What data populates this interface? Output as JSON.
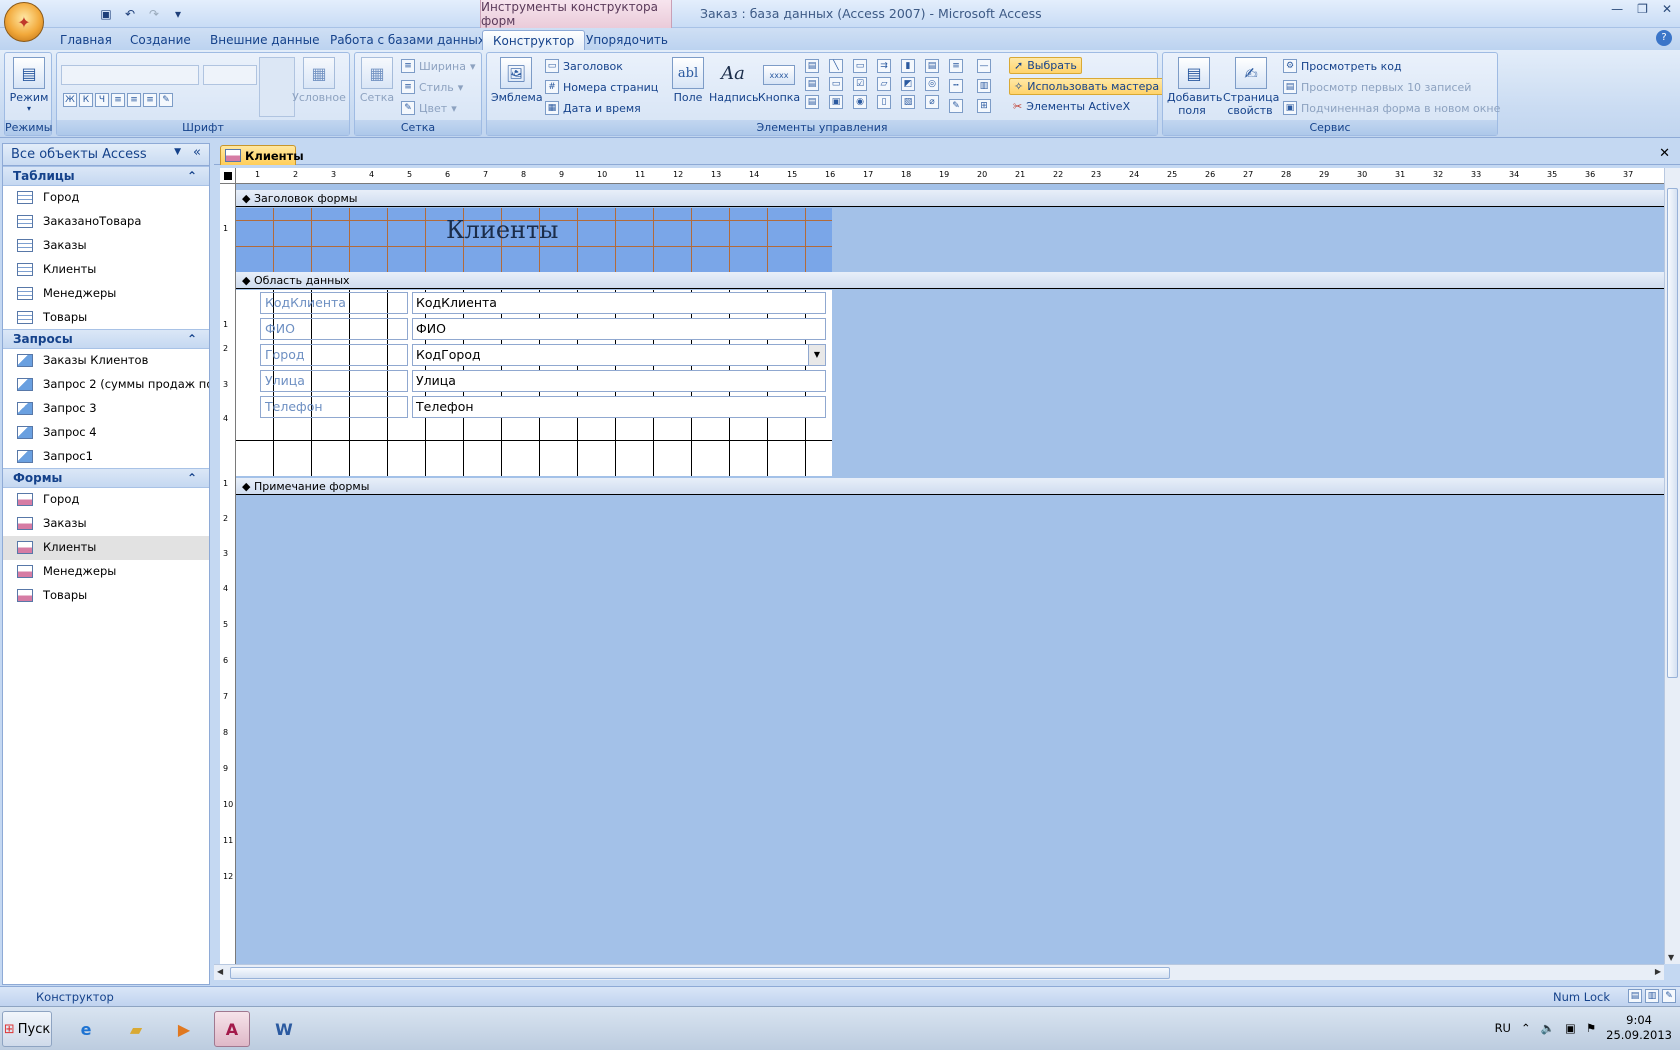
{
  "window": {
    "app_title": "Заказ : база данных (Access 2007) - Microsoft Access",
    "context_tab_title": "Инструменты конструктора форм"
  },
  "tabs": [
    "Главная",
    "Создание",
    "Внешние данные",
    "Работа с базами данных",
    "Конструктор",
    "Упорядочить"
  ],
  "active_tab": "Конструктор",
  "ribbon": {
    "views": {
      "label": "Режимы",
      "mode_btn": "Режим"
    },
    "font": {
      "label": "Шрифт",
      "conditional": "Условное"
    },
    "grid": {
      "label": "Сетка",
      "grid_btn": "Сетка",
      "width": "Ширина",
      "style": "Стиль",
      "color": "Цвет"
    },
    "controls": {
      "label": "Элементы управления",
      "emblem": "Эмблема",
      "title_btn": "Заголовок",
      "page_numbers": "Номера страниц",
      "date_time": "Дата и время",
      "field": "Поле",
      "caption": "Надпись",
      "button": "Кнопка",
      "select": "Выбрать",
      "use_wizards": "Использовать мастера",
      "activex": "Элементы ActiveX"
    },
    "tools": {
      "label": "Сервис",
      "add_fields": "Добавить поля",
      "property_sheet": "Страница свойств",
      "view_code": "Просмотреть код",
      "view_first10": "Просмотр первых 10 записей",
      "subform_new_window": "Подчиненная форма в новом окне"
    }
  },
  "nav": {
    "header": "Все объекты Access",
    "groups": [
      {
        "title": "Таблицы",
        "items": [
          "Город",
          "ЗаказаноТовара",
          "Заказы",
          "Клиенты",
          "Менеджеры",
          "Товары"
        ]
      },
      {
        "title": "Запросы",
        "items": [
          "Заказы Клиентов",
          "Запрос 2 (суммы продаж по ...",
          "Запрос 3",
          "Запрос 4",
          "Запрос1"
        ]
      },
      {
        "title": "Формы",
        "items": [
          "Город",
          "Заказы",
          "Клиенты",
          "Менеджеры",
          "Товары"
        ]
      }
    ],
    "selected": "Клиенты"
  },
  "doc": {
    "tab_label": "Клиенты",
    "sections": {
      "header": "Заголовок формы",
      "detail": "Область данных",
      "footer": "Примечание формы"
    },
    "form_title": "Клиенты",
    "fields": [
      {
        "label": "КодКлиента",
        "control": "КодКлиента",
        "combo": false
      },
      {
        "label": "ФИО",
        "control": "ФИО",
        "combo": false
      },
      {
        "label": "Город",
        "control": "КодГород",
        "combo": true
      },
      {
        "label": "Улица",
        "control": "Улица",
        "combo": false
      },
      {
        "label": "Телефон",
        "control": "Телефон",
        "combo": false
      }
    ]
  },
  "statusbar": {
    "mode": "Конструктор",
    "numlock": "Num Lock"
  },
  "taskbar": {
    "start": "Пуск",
    "lang": "RU",
    "time": "9:04",
    "date": "25.09.2013"
  }
}
